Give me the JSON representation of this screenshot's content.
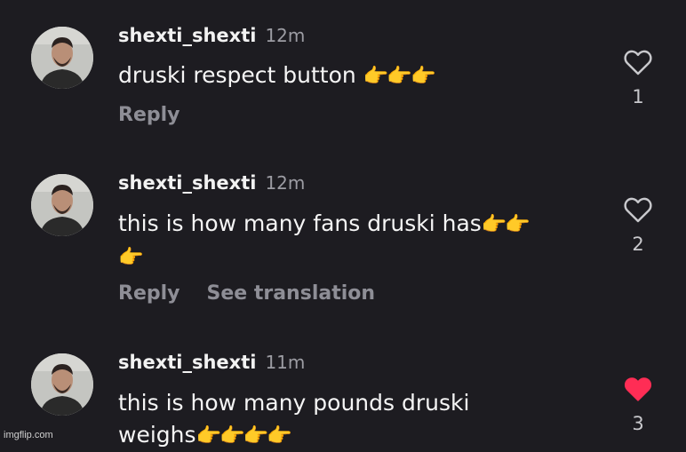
{
  "comments": [
    {
      "username": "shexti_shexti",
      "time": "12m",
      "text": "druski respect button ",
      "emoji": "👉👉👉",
      "actions": [
        "Reply"
      ],
      "likes": "1",
      "liked": false
    },
    {
      "username": "shexti_shexti",
      "time": "12m",
      "text": "this is how many fans druski has",
      "emoji": "👉👉👉",
      "actions": [
        "Reply",
        "See translation"
      ],
      "likes": "2",
      "liked": false
    },
    {
      "username": "shexti_shexti",
      "time": "11m",
      "text": "this is how many pounds druski weighs",
      "emoji": "👉👉👉👉",
      "actions": [],
      "likes": "3",
      "liked": true
    }
  ],
  "colors": {
    "background": "#1d1c21",
    "liked_heart": "#ff2d55",
    "muted_text": "#8e8e96"
  },
  "icons": {
    "like_empty": "heart-outline-icon",
    "like_filled": "heart-filled-icon"
  },
  "watermark": "imgflip.com"
}
